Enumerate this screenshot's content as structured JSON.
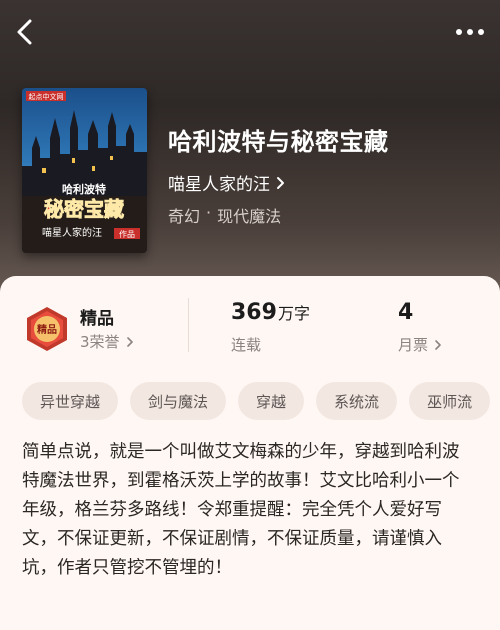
{
  "book": {
    "title": "哈利波特与秘密宝藏",
    "author": "喵星人家的汪",
    "genre": "奇幻",
    "separator": "·",
    "subgenre": "现代魔法",
    "cover": {
      "brand": "起点中文网",
      "title_line1": "哈利波特",
      "title_line2": "秘密宝藏",
      "author": "喵星人家的汪",
      "tag": "作品"
    }
  },
  "stats": {
    "rank": {
      "title": "精品",
      "sub": "3荣誉",
      "badge_text": "精品"
    },
    "words": {
      "value": "369",
      "unit": "万字",
      "label": "连载"
    },
    "votes": {
      "value": "4",
      "label": "月票"
    }
  },
  "tags": [
    "异世穿越",
    "剑与魔法",
    "穿越",
    "系统流",
    "巫师流"
  ],
  "description": "简单点说，就是一个叫做艾文梅森的少年，穿越到哈利波特魔法世界，到霍格沃茨上学的故事！艾文比哈利小一个年级，格兰芬多路线！令郑重提醒：完全凭个人爱好写文，不保证更新，不保证剧情，不保证质量，请谨慎入坑，作者只管挖不管埋的！",
  "icons": [
    "back-arrow-icon",
    "more-dots-icon",
    "chevron-right-icon",
    "rank-badge-icon"
  ]
}
